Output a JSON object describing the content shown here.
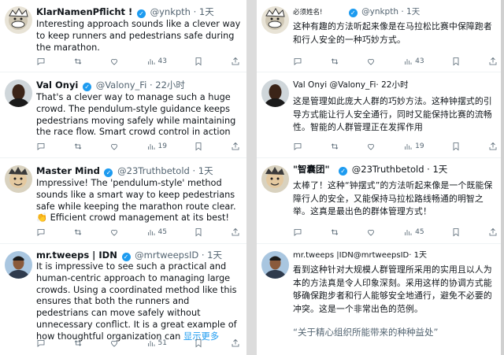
{
  "left": {
    "tweets": [
      {
        "name": "KlarNamenPflicht !",
        "handle": "@ynkpth",
        "time": "· 1天",
        "body": "Interesting approach sounds like a clever way to keep runners and pedestrians safe during the marathon.",
        "views": "43"
      },
      {
        "name": "Val Onyi",
        "handle": "@Valony_Fi",
        "time": "· 22小时",
        "body": "That's a clever way to manage such a huge crowd. The pendulum-style guidance keeps pedestrians moving safely while maintaining the race flow. Smart crowd control in action",
        "views": "19"
      },
      {
        "name": "Master Mind",
        "handle": "@23Truthbetold",
        "time": "· 1天",
        "body": "Impressive! The 'pendulum-style' method sounds like a smart way to keep pedestrians safe while keeping the marathon route clear. 👏 Efficient crowd management at its best!",
        "views": "45"
      },
      {
        "name": "mr.tweeps | IDN",
        "handle": "@mrtweepsID",
        "time": "· 1天",
        "body": "It is impressive to see such a practical and human-centric approach to managing large crowds. Using a coordinated method like this ensures that both the runners and pedestrians can move safely without unnecessary conflict. It is a great example of how thoughtful organization can",
        "more": "显示更多",
        "views": "51"
      }
    ]
  },
  "right": {
    "tweets": [
      {
        "name": "必须姓名!",
        "handle": "@ynkpth",
        "time": "· 1天",
        "body": "这种有趣的方法听起来像是在马拉松比赛中保障跑者和行人安全的一种巧妙方式。",
        "views": "43"
      },
      {
        "name": "Val Onyi",
        "handle": "@Valony_Fi",
        "time": "· 22小时",
        "body": "这是管理如此庞大人群的巧妙方法。这种钟摆式的引导方式能让行人安全通行，同时又能保持比赛的流畅性。智能的人群管理正在发挥作用",
        "views": "19"
      },
      {
        "name": "\"智囊团\"",
        "handle": "@23Truthbetold",
        "time": "· 1天",
        "body": "太棒了！这种“钟摆式”的方法听起来像是一个既能保障行人的安全，又能保持马拉松路线畅通的明智之举。这真是最出色的群体管理方式！",
        "views": "45"
      },
      {
        "name": "mr.tweeps",
        "handle": "|IDN@mrtweepsID",
        "time": "· 1天",
        "body": "看到这种针对大规模人群管理所采用的实用且以人为本的方法真是令人印象深刻。采用这样的协调方式能够确保跑步者和行人能够安全地通行，避免不必要的冲突。这是一个非常出色的范例。",
        "quote": "“关于精心组织所能带来的种种益处”"
      }
    ]
  }
}
